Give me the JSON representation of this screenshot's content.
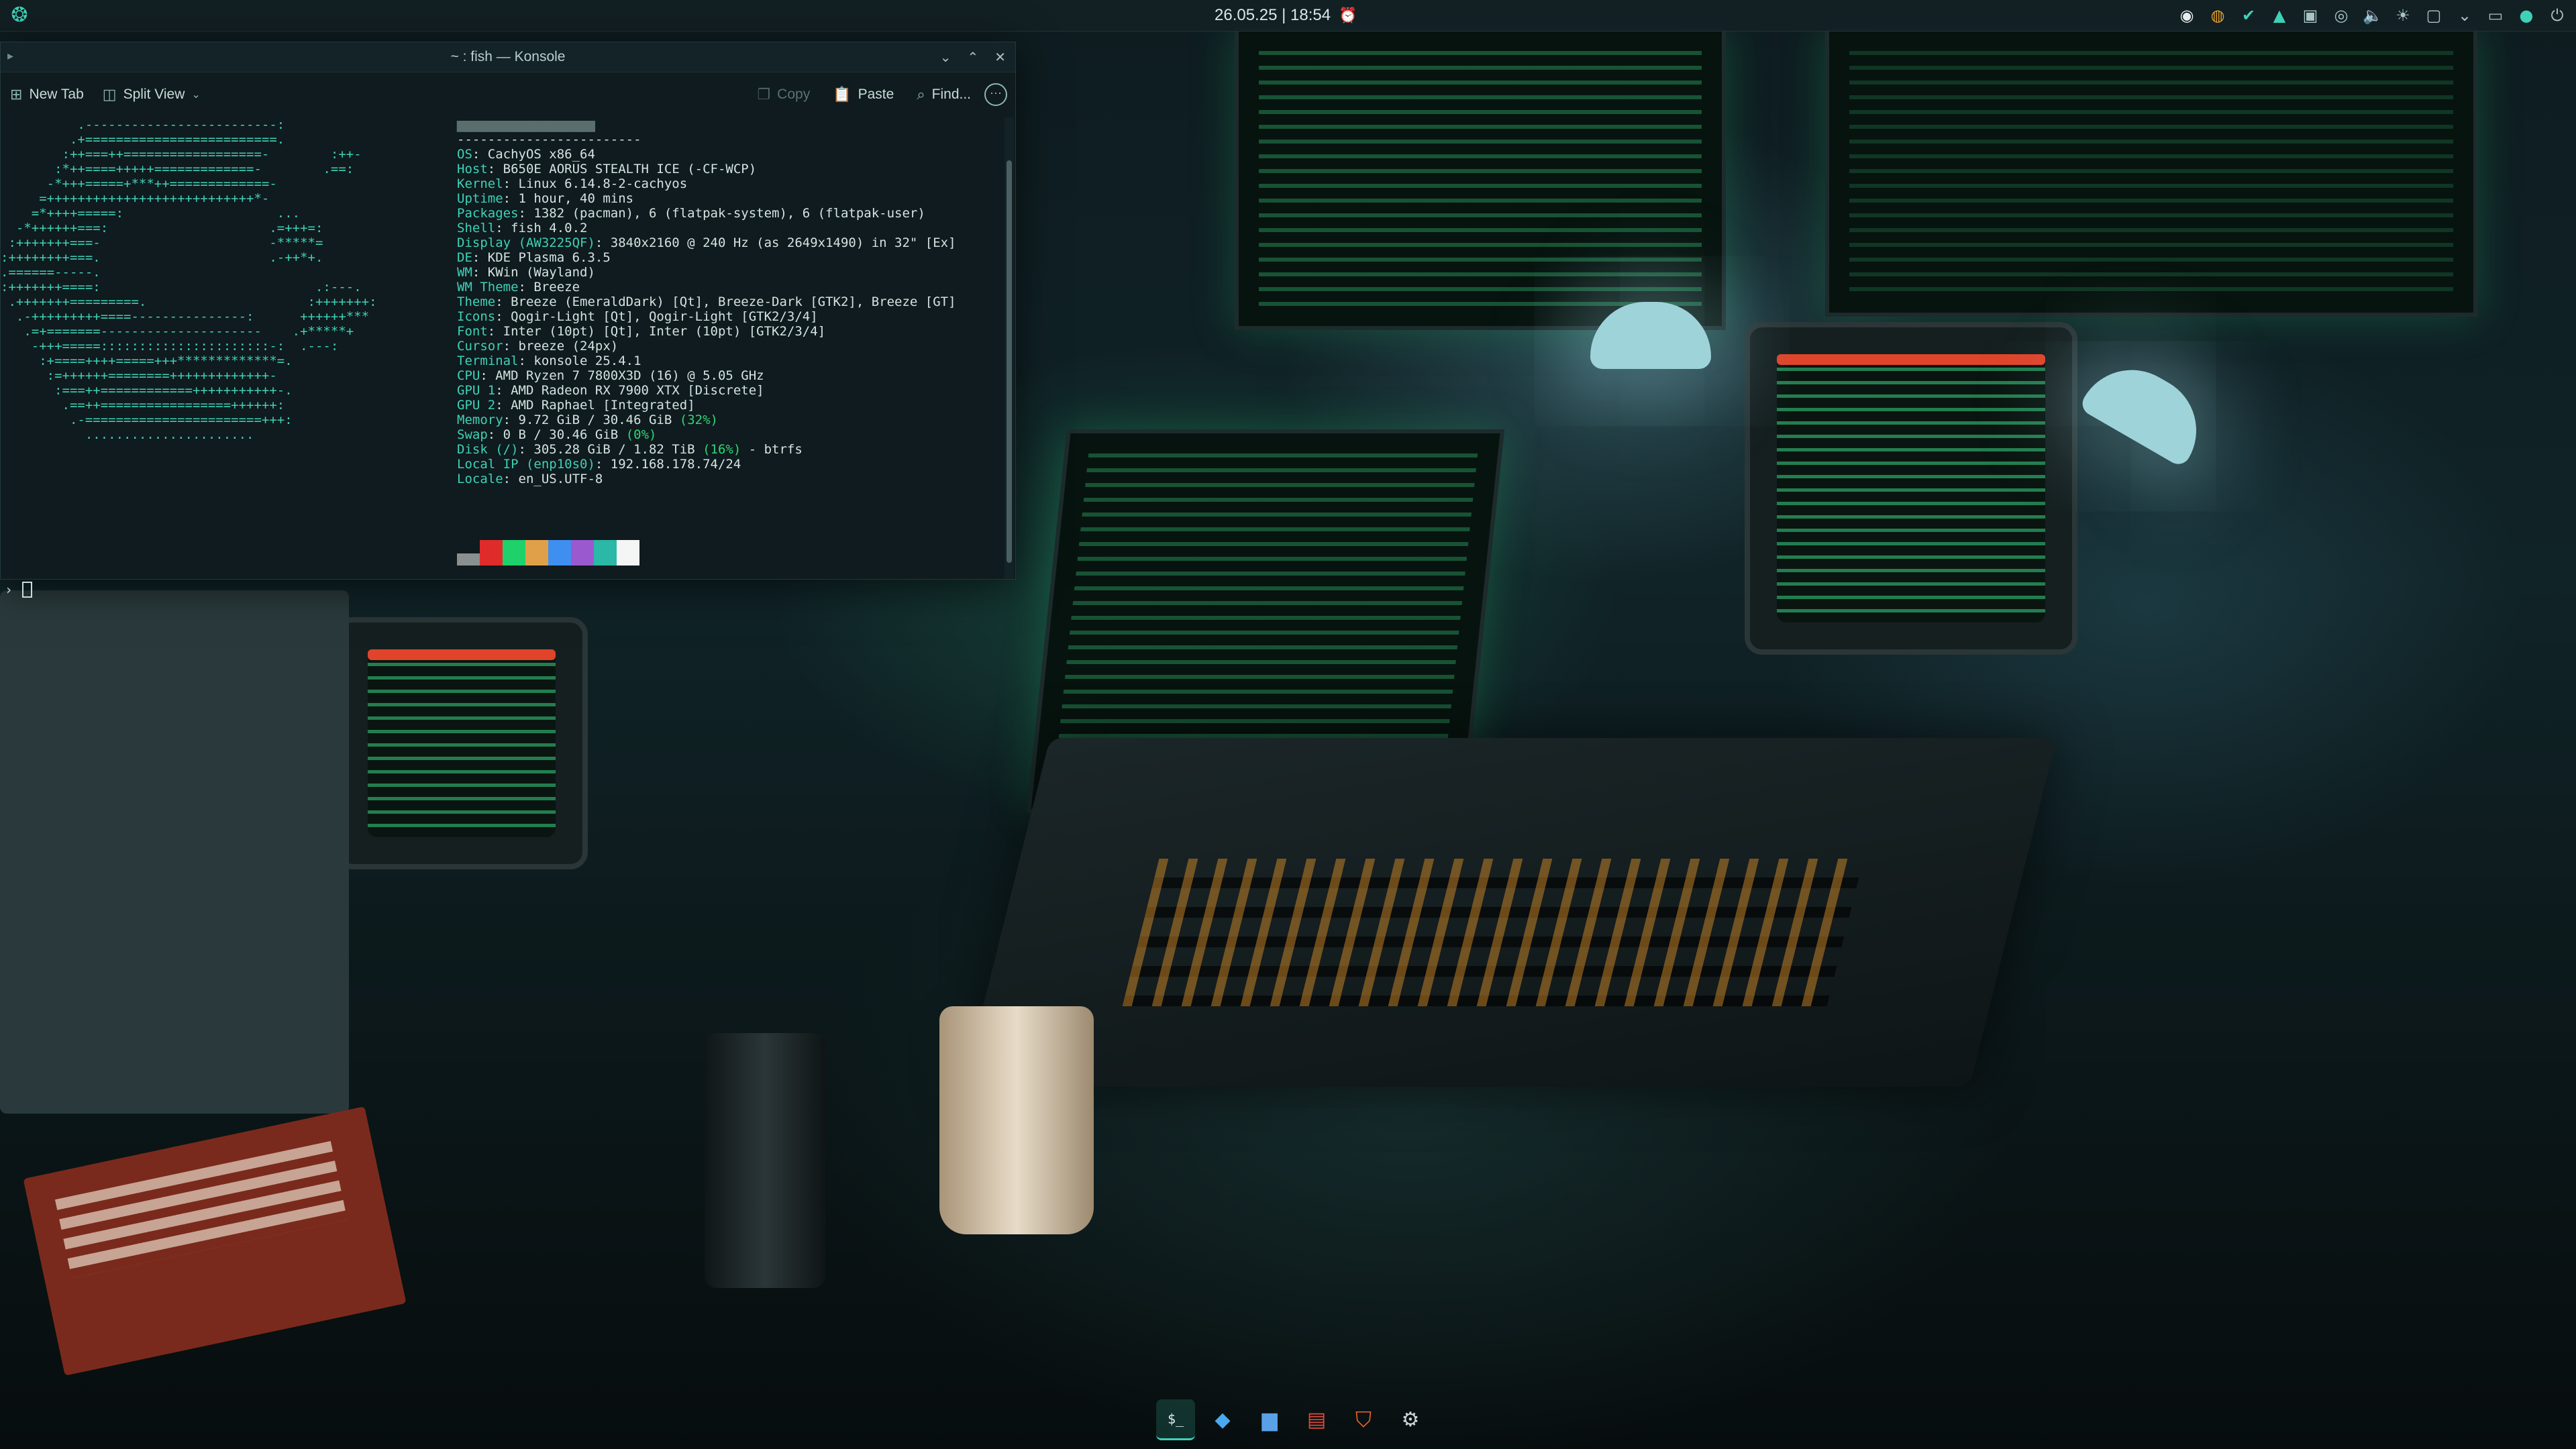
{
  "top_panel": {
    "clock": "26.05.25 | 18:54",
    "tray_icons": [
      "discord-icon",
      "chrome-icon",
      "steam-icon",
      "arch-update-icon",
      "clipboard-icon",
      "vpn-icon",
      "volume-icon",
      "brightness-icon",
      "notifications-icon",
      "chevron-down-icon",
      "network-icon",
      "battery-icon",
      "power-icon"
    ]
  },
  "konsole": {
    "title": "~ : fish — Konsole",
    "toolbar": {
      "new_tab": "New Tab",
      "split_view": "Split View",
      "copy": "Copy",
      "paste": "Paste",
      "find": "Find..."
    },
    "fastfetch": {
      "logo": "          .-------------------------:\n         .+=========================.\n        :++===++==================-        :++-\n       :*++====+++++=============-        .==:\n      -*+++=====+***++=============-\n     =+++++++++++++++++++++++++++*-\n    =*++++=====:                    ...\n  -*++++++===:                     .=+++=:\n :+++++++===-                      -*****=\n:++++++++===.                      .-++*+.\n.======-----.\n:+++++++====:                            .:---.\n .+++++++=========.                     :+++++++:\n  .-+++++++++====---------------:      ++++++***\n   .=+=======---------------------    .+*****+\n    -+++=====::::::::::::::::::::::-:  .---:\n     :+====++++=====+++*************=.\n      :=++++++========+++++++++++++-\n       :===++============+++++++++++-.\n        .==++=================++++++:\n         .-=======================+++:\n           ......................",
      "header_user": "▆▆▆▆▆▆▆▆▆▆▆▆▆▆▆▆▆▆",
      "header_sep": "------------------------",
      "rows": [
        {
          "key": "OS",
          "val": "CachyOS x86_64"
        },
        {
          "key": "Host",
          "val": "B650E AORUS STEALTH ICE (-CF-WCP)"
        },
        {
          "key": "Kernel",
          "val": "Linux 6.14.8-2-cachyos"
        },
        {
          "key": "Uptime",
          "val": "1 hour, 40 mins"
        },
        {
          "key": "Packages",
          "val": "1382 (pacman), 6 (flatpak-system), 6 (flatpak-user)"
        },
        {
          "key": "Shell",
          "val": "fish 4.0.2"
        },
        {
          "key": "Display (AW3225QF)",
          "val": "3840x2160 @ 240 Hz (as 2649x1490) in 32\" [Ex]"
        },
        {
          "key": "DE",
          "val": "KDE Plasma 6.3.5"
        },
        {
          "key": "WM",
          "val": "KWin (Wayland)"
        },
        {
          "key": "WM Theme",
          "val": "Breeze"
        },
        {
          "key": "Theme",
          "val": "Breeze (EmeraldDark) [Qt], Breeze-Dark [GTK2], Breeze [GT]"
        },
        {
          "key": "Icons",
          "val": "Qogir-Light [Qt], Qogir-Light [GTK2/3/4]"
        },
        {
          "key": "Font",
          "val": "Inter (10pt) [Qt], Inter (10pt) [GTK2/3/4]"
        },
        {
          "key": "Cursor",
          "val": "breeze (24px)"
        },
        {
          "key": "Terminal",
          "val": "konsole 25.4.1"
        },
        {
          "key": "CPU",
          "val": "AMD Ryzen 7 7800X3D (16) @ 5.05 GHz"
        },
        {
          "key": "GPU 1",
          "val": "AMD Radeon RX 7900 XTX [Discrete]"
        },
        {
          "key": "GPU 2",
          "val": "AMD Raphael [Integrated]"
        },
        {
          "key": "Memory",
          "val": "9.72 GiB / 30.46 GiB ",
          "pct": "(32%)"
        },
        {
          "key": "Swap",
          "val": "0 B / 30.46 GiB ",
          "pct": "(0%)"
        },
        {
          "key": "Disk (/)",
          "val": "305.28 GiB / 1.82 TiB ",
          "pct": "(16%)",
          "tail": " - btrfs"
        },
        {
          "key": "Local IP (enp10s0)",
          "val": "192.168.178.74/24"
        },
        {
          "key": "Locale",
          "val": "en_US.UTF-8"
        }
      ],
      "palette": [
        "#8a8f90",
        "#e02b2b",
        "#1fd16a",
        "#e0a04a",
        "#3f8ff0",
        "#9b59d0",
        "#2bb8a6",
        "#f4f6f6"
      ]
    },
    "prompt_symbol": "›"
  },
  "taskbar": {
    "items": [
      {
        "name": "konsole",
        "glyph": "$_"
      },
      {
        "name": "vscode",
        "glyph": "◆"
      },
      {
        "name": "file-manager",
        "glyph": "▆"
      },
      {
        "name": "office",
        "glyph": "▤"
      },
      {
        "name": "brave",
        "glyph": "⛉"
      },
      {
        "name": "steam",
        "glyph": "⚙"
      }
    ]
  },
  "colors": {
    "accent": "#3fd1b8",
    "panel_bg": "#122024",
    "terminal_bg": "#0f1b1e",
    "percent_green": "#2fd675"
  }
}
